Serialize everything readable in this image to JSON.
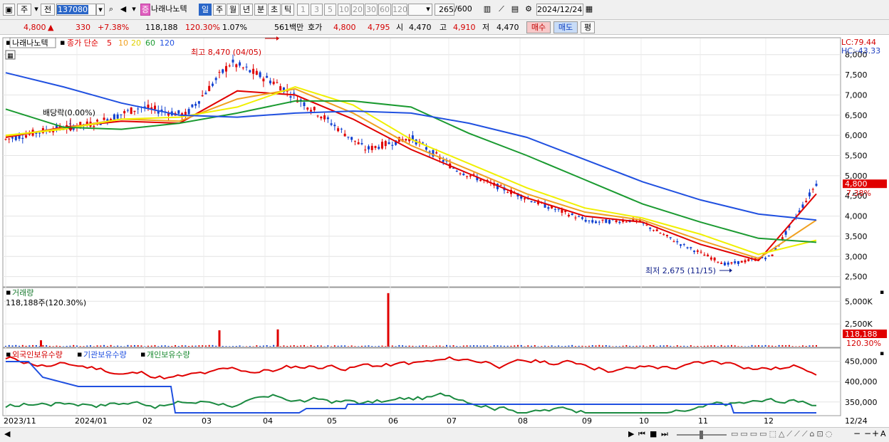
{
  "toolbar": {
    "market": "주",
    "prefix": "전",
    "code": "137080",
    "badge": "증",
    "stock_name": "나래나노텍",
    "period_day": "일",
    "period_week": "주",
    "period_month": "월",
    "period_year": "년",
    "period_minute": "분",
    "period_second": "초",
    "period_tick": "틱",
    "intervals": [
      "1",
      "3",
      "5",
      "10",
      "20",
      "30",
      "60",
      "120"
    ],
    "count": "265",
    "count_total": "/600",
    "date": "2024/12/24"
  },
  "quote": {
    "price": "4,800",
    "arrow": "▲",
    "change": "330",
    "change_pct": "+7.38%",
    "volume": "118,188",
    "volume_ratio": "120.30%",
    "turnover_pct": "1.07%",
    "amount": "561백만",
    "bid_label": "호가",
    "ask": "4,800",
    "bid": "4,795",
    "open_label": "시",
    "open": "4,470",
    "high_label": "고",
    "high": "4,910",
    "low_label": "저",
    "low": "4,470",
    "buy_button": "매수",
    "sell_button": "매도",
    "eval_button": "평"
  },
  "chart": {
    "stock_label": "나래나노텍",
    "ma_label": "종가 단순",
    "ma_periods": [
      "5",
      "10",
      "20",
      "60",
      "120"
    ],
    "ma_colors": [
      "#e00000",
      "#f0a020",
      "#f0f000",
      "#1a9a30",
      "#2050e0"
    ],
    "lc": "LC:79.44",
    "hc": "HC:-43.33",
    "high_note": "최고 8,470 (04/05)",
    "low_note": "최저 2,675 (11/15)",
    "dividend_note": "배당락(0.00%)",
    "price_ticks": [
      "8,000",
      "7,500",
      "7,000",
      "6,500",
      "6,000",
      "5,500",
      "5,000",
      "4,500",
      "4,000",
      "3,500",
      "3,000",
      "2,500"
    ],
    "current_price": "4,800",
    "current_pct": "7.38%",
    "volume_label": "거래량",
    "volume_value": "118,188주(120.30%)",
    "volume_ticks": [
      "5,000K",
      "2,500K"
    ],
    "volume_current": "118,188",
    "volume_current_pct": "120.30%",
    "holdings_labels": [
      "외국인보유수량",
      "기관보유수량",
      "개인보유수량"
    ],
    "holdings_ticks": [
      "450,000",
      "400,000",
      "350,000"
    ],
    "x_labels": [
      "2023/11",
      "2024/01",
      "02",
      "03",
      "04",
      "05",
      "06",
      "07",
      "08",
      "09",
      "10",
      "11",
      "12"
    ],
    "x_right_label": "12/24"
  },
  "chart_data": {
    "type": "line",
    "x": [
      "2023/11",
      "2023/12",
      "2024/01",
      "2024/02",
      "2024/03",
      "2024/04",
      "2024/05",
      "2024/06",
      "2024/07",
      "2024/08",
      "2024/09",
      "2024/10",
      "2024/11",
      "2024/12",
      "2024/12/24"
    ],
    "series": [
      {
        "name": "5",
        "values": [
          5950,
          6200,
          6350,
          6300,
          7100,
          7000,
          6400,
          5650,
          5050,
          4450,
          4000,
          3850,
          3300,
          2900,
          4550
        ]
      },
      {
        "name": "10",
        "values": [
          5980,
          6180,
          6400,
          6350,
          6900,
          7150,
          6550,
          5750,
          5150,
          4550,
          4100,
          3900,
          3400,
          2950,
          3900
        ]
      },
      {
        "name": "20",
        "values": [
          6000,
          6150,
          6400,
          6450,
          6700,
          7200,
          6750,
          5900,
          5300,
          4700,
          4200,
          3950,
          3550,
          3050,
          3400
        ]
      },
      {
        "name": "60",
        "values": [
          6650,
          6200,
          6150,
          6300,
          6550,
          6850,
          6850,
          6700,
          6050,
          5500,
          4900,
          4300,
          3850,
          3450,
          3350
        ]
      },
      {
        "name": "120",
        "values": [
          7550,
          7200,
          6800,
          6500,
          6450,
          6550,
          6600,
          6550,
          6300,
          5950,
          5400,
          4850,
          4400,
          4050,
          3900
        ]
      }
    ],
    "candles_close": [
      5900,
      6150,
      6300,
      6700,
      6500,
      7800,
      7300,
      6500,
      5650,
      5950,
      5150,
      4700,
      4250,
      3850,
      3900,
      3300,
      2800,
      3000,
      4800
    ],
    "high": {
      "value": 8470,
      "date": "04/05"
    },
    "low": {
      "value": 2675,
      "date": "11/15"
    },
    "volume_spikes": [
      {
        "x": "2024/03",
        "v": 1800
      },
      {
        "x": "2024/04",
        "v": 1900
      },
      {
        "x": "2024/06",
        "v": 5900
      }
    ],
    "ylim": [
      2300,
      8400
    ]
  }
}
